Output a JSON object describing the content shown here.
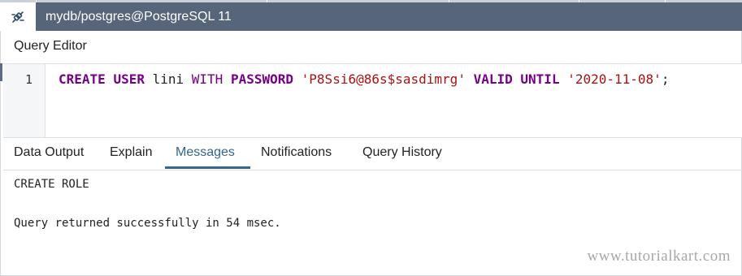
{
  "titlebar": {
    "connection_label": "mydb/postgres@PostgreSQL 11",
    "icon": "unplug-connection-icon"
  },
  "editor": {
    "label": "Query Editor",
    "line_number": "1",
    "tokens": {
      "t1": "CREATE",
      "t2": "USER",
      "t3": "lini",
      "t4": "WITH",
      "t5": "PASSWORD",
      "t6": "'P8Ssi6@86s$sasdimrg'",
      "t7": "VALID",
      "t8": "UNTIL",
      "t9": "'2020-11-08'",
      "t10": ";"
    }
  },
  "tabs": {
    "data_output": "Data Output",
    "explain": "Explain",
    "messages": "Messages",
    "notifications": "Notifications",
    "query_history": "Query History",
    "active": "Messages"
  },
  "messages": {
    "line1": "CREATE ROLE",
    "line2": "Query returned successfully in 54 msec."
  },
  "watermark": "www.tutorialkart.com",
  "colors": {
    "titlebar": "#56657a",
    "keyword": "#770088",
    "string": "#aa1111",
    "active_tab": "#326690"
  }
}
